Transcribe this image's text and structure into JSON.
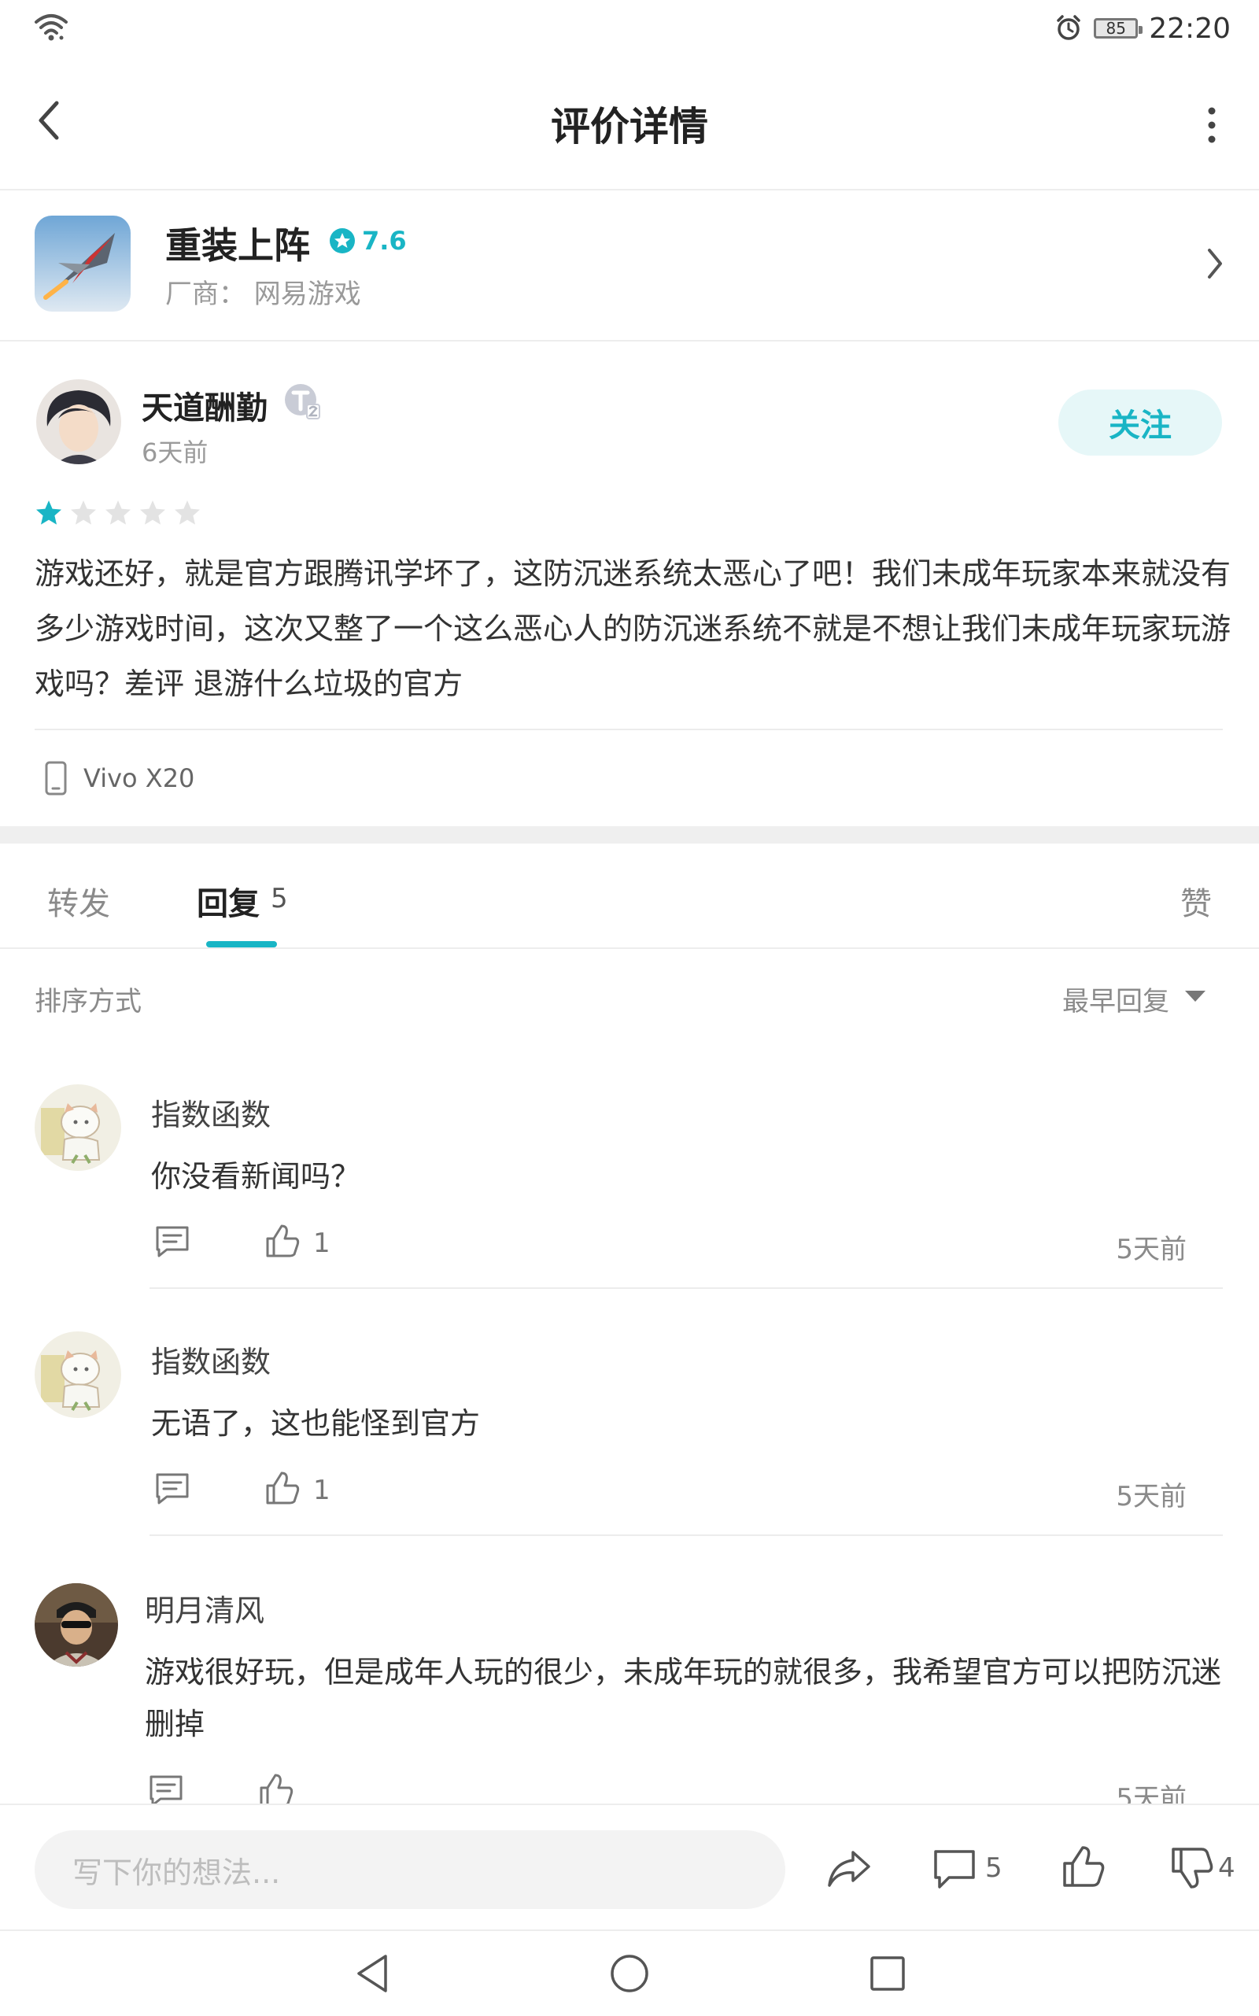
{
  "status_bar": {
    "time": "22:20",
    "battery": "85"
  },
  "header": {
    "title": "评价详情"
  },
  "game": {
    "name": "重装上阵",
    "rating": "7.6",
    "vendor": "厂商：  网易游戏"
  },
  "review": {
    "author": "天道酬勤",
    "time": "6天前",
    "follow_label": "关注",
    "stars": 1,
    "stars_max": 5,
    "text": "游戏还好，就是官方跟腾讯学坏了，这防沉迷系统太恶心了吧！我们未成年玩家本来就没有多少游戏时间，这次又整了一个这么恶心人的防沉迷系统不就是不想让我们未成年玩家玩游戏吗？差评 退游什么垃圾的官方",
    "device": "Vivo X20"
  },
  "tabs": {
    "forward": "转发",
    "reply": "回复",
    "reply_count": "5",
    "like": "赞"
  },
  "sort": {
    "label": "排序方式",
    "value": "最早回复"
  },
  "comments": [
    {
      "name": "指数函数",
      "text": "你没看新闻吗？",
      "likes": "1",
      "time": "5天前"
    },
    {
      "name": "指数函数",
      "text": "无语了，这也能怪到官方",
      "likes": "1",
      "time": "5天前"
    },
    {
      "name": "明月清风",
      "text": "游戏很好玩，但是成年人玩的很少，未成年玩的就很多，我希望官方可以把防沉迷删掉",
      "likes": "",
      "time": "5天前"
    }
  ],
  "bottom_bar": {
    "input_placeholder": "写下你的想法...",
    "comment_count": "5",
    "dislike_count": "4"
  },
  "colors": {
    "accent": "#19b5c5",
    "star_off": "#e3e3e3"
  }
}
